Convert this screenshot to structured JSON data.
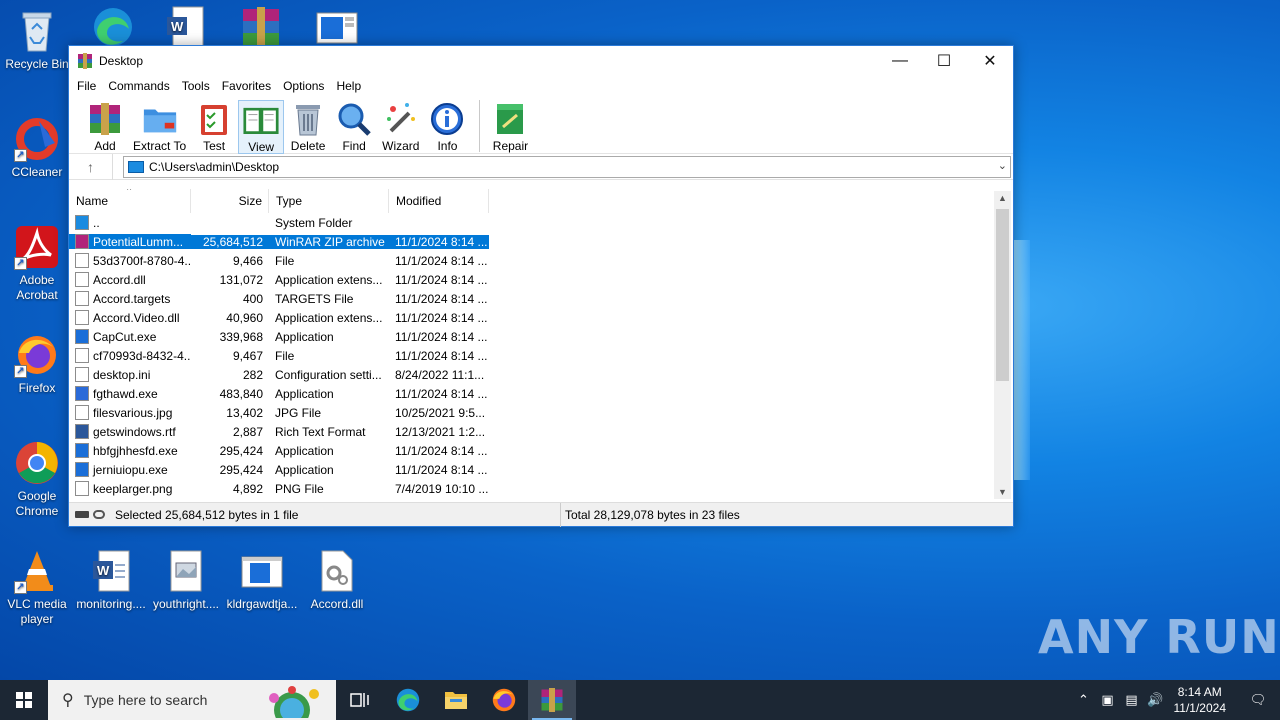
{
  "desktop": {
    "left_icons": [
      {
        "label": "Recycle Bin",
        "icon": "recycle-bin-icon"
      },
      {
        "label": "CCleaner",
        "icon": "ccleaner-icon"
      },
      {
        "label": "Adobe Acrobat",
        "icon": "acrobat-icon"
      },
      {
        "label": "Firefox",
        "icon": "firefox-icon"
      },
      {
        "label": "Google Chrome",
        "icon": "chrome-icon"
      },
      {
        "label": "VLC media player",
        "icon": "vlc-icon"
      }
    ],
    "bottom_icons": [
      {
        "label": "monitoring....",
        "icon": "word-doc-icon"
      },
      {
        "label": "youthright....",
        "icon": "image-file-icon"
      },
      {
        "label": "kldrgawdtja...",
        "icon": "window-app-icon"
      },
      {
        "label": "Accord.dll",
        "icon": "dll-file-icon"
      }
    ],
    "watermark": "ANY RUN"
  },
  "window": {
    "title": "Desktop",
    "menu": [
      "File",
      "Commands",
      "Tools",
      "Favorites",
      "Options",
      "Help"
    ],
    "toolbar": [
      {
        "label": "Add",
        "icon": "add-archive-icon"
      },
      {
        "label": "Extract To",
        "icon": "extract-folder-icon"
      },
      {
        "label": "Test",
        "icon": "test-clipboard-icon"
      },
      {
        "label": "View",
        "icon": "view-book-icon"
      },
      {
        "label": "Delete",
        "icon": "trash-icon"
      },
      {
        "label": "Find",
        "icon": "magnifier-icon"
      },
      {
        "label": "Wizard",
        "icon": "wizard-wand-icon"
      },
      {
        "label": "Info",
        "icon": "info-icon"
      },
      {
        "label": "Repair",
        "icon": "repair-icon"
      }
    ],
    "address": "C:\\Users\\admin\\Desktop",
    "columns": [
      "Name",
      "Size",
      "Type",
      "Modified"
    ],
    "files": [
      {
        "name": "..",
        "size": "",
        "type": "System Folder",
        "modified": ""
      },
      {
        "name": "PotentialLumm...",
        "size": "25,684,512",
        "type": "WinRAR ZIP archive",
        "modified": "11/1/2024 8:14 ..."
      },
      {
        "name": "53d3700f-8780-4...",
        "size": "9,466",
        "type": "File",
        "modified": "11/1/2024 8:14 ..."
      },
      {
        "name": "Accord.dll",
        "size": "131,072",
        "type": "Application extens...",
        "modified": "11/1/2024 8:14 ..."
      },
      {
        "name": "Accord.targets",
        "size": "400",
        "type": "TARGETS File",
        "modified": "11/1/2024 8:14 ..."
      },
      {
        "name": "Accord.Video.dll",
        "size": "40,960",
        "type": "Application extens...",
        "modified": "11/1/2024 8:14 ..."
      },
      {
        "name": "CapCut.exe",
        "size": "339,968",
        "type": "Application",
        "modified": "11/1/2024 8:14 ..."
      },
      {
        "name": "cf70993d-8432-4...",
        "size": "9,467",
        "type": "File",
        "modified": "11/1/2024 8:14 ..."
      },
      {
        "name": "desktop.ini",
        "size": "282",
        "type": "Configuration setti...",
        "modified": "8/24/2022 11:1..."
      },
      {
        "name": "fgthawd.exe",
        "size": "483,840",
        "type": "Application",
        "modified": "11/1/2024 8:14 ..."
      },
      {
        "name": "filesvarious.jpg",
        "size": "13,402",
        "type": "JPG File",
        "modified": "10/25/2021 9:5..."
      },
      {
        "name": "getswindows.rtf",
        "size": "2,887",
        "type": "Rich Text Format",
        "modified": "12/13/2021 1:2..."
      },
      {
        "name": "hbfgjhhesfd.exe",
        "size": "295,424",
        "type": "Application",
        "modified": "11/1/2024 8:14 ..."
      },
      {
        "name": "jerniuiopu.exe",
        "size": "295,424",
        "type": "Application",
        "modified": "11/1/2024 8:14 ..."
      },
      {
        "name": "keeplarger.png",
        "size": "4,892",
        "type": "PNG File",
        "modified": "7/4/2019 10:10 ..."
      }
    ],
    "selected_index": 1,
    "status_left": "Selected 25,684,512 bytes in 1 file",
    "status_right": "Total 28,129,078 bytes in 23 files"
  },
  "taskbar": {
    "search_placeholder": "Type here to search",
    "time": "8:14 AM",
    "date": "11/1/2024"
  }
}
